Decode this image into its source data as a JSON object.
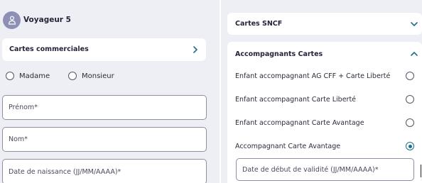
{
  "traveler": {
    "name": "Voyageur 5"
  },
  "commercial_cards": {
    "title": "Cartes commerciales"
  },
  "civility": {
    "options": [
      "Madame",
      "Monsieur"
    ]
  },
  "fields": {
    "first_name": "Prénom*",
    "last_name": "Nom*",
    "birth_date": "Date de naissance (JJ/MM/AAAA)*"
  },
  "sncf_cards": {
    "title": "Cartes SNCF"
  },
  "companion_cards": {
    "title": "Accompagnants Cartes",
    "options": [
      {
        "label": "Enfant accompagnant AG CFF + Carte Liberté",
        "selected": false
      },
      {
        "label": "Enfant accompagnant Carte Liberté",
        "selected": false
      },
      {
        "label": "Enfant accompagnant Carte Avantage",
        "selected": false
      },
      {
        "label": "Accompagnant Carte Avantage",
        "selected": true
      }
    ],
    "validity_field": "Date de début de validité (JJ/MM/AAAA)*"
  },
  "colors": {
    "accent": "#1d6e8a",
    "panel_bg": "#eeeff4",
    "avatar": "#8d8fb4"
  },
  "icons": {
    "avatar": "person-icon",
    "expand": "chevron-right-icon",
    "collapse": "chevron-up-icon",
    "dropdown": "chevron-down-icon"
  }
}
